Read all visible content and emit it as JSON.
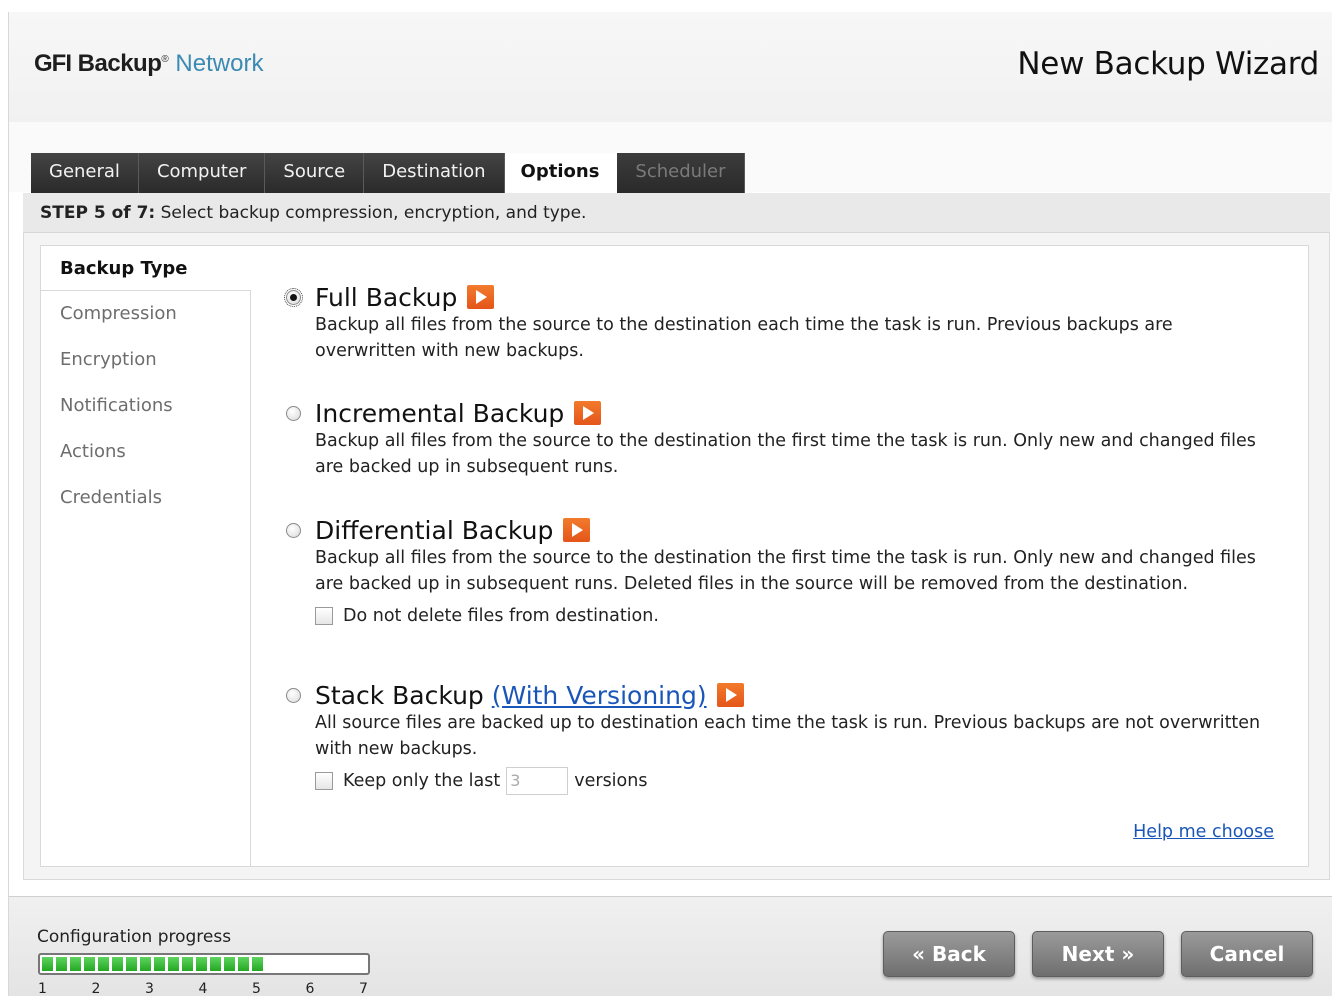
{
  "header": {
    "logo_gfi": "GFI",
    "logo_backup": "Backup",
    "logo_reg": "®",
    "logo_network": "Network",
    "title": "New Backup Wizard"
  },
  "tabs": [
    {
      "label": "General",
      "state": "normal"
    },
    {
      "label": "Computer",
      "state": "normal"
    },
    {
      "label": "Source",
      "state": "normal"
    },
    {
      "label": "Destination",
      "state": "normal"
    },
    {
      "label": "Options",
      "state": "active"
    },
    {
      "label": "Scheduler",
      "state": "disabled"
    }
  ],
  "step": {
    "label": "STEP 5 of 7:",
    "text": " Select backup compression, encryption, and type."
  },
  "side_menu": [
    {
      "label": "Backup Type",
      "active": true
    },
    {
      "label": "Compression",
      "active": false
    },
    {
      "label": "Encryption",
      "active": false
    },
    {
      "label": "Notifications",
      "active": false
    },
    {
      "label": "Actions",
      "active": false
    },
    {
      "label": "Credentials",
      "active": false
    }
  ],
  "options": {
    "full": {
      "title": "Full Backup",
      "selected": true,
      "description": "Backup all files from the source to the destination each time the task is run. Previous backups are overwritten with new backups."
    },
    "incremental": {
      "title": "Incremental Backup",
      "selected": false,
      "description": "Backup all files from the source to the destination the first time the task is run. Only new and changed files are backed up in subsequent runs."
    },
    "differential": {
      "title": "Differential Backup",
      "selected": false,
      "description": "Backup all files from the source to the destination the first time the task is run. Only new and changed files are backed up in subsequent runs. Deleted files in the source will be removed from the destination.",
      "checkbox_label": "Do not delete files from destination.",
      "checkbox_checked": false
    },
    "stack": {
      "title": "Stack Backup",
      "versioning_link": "(With Versioning)",
      "selected": false,
      "description": "All source files are backed up to destination each time the task is run. Previous backups are not overwritten with new backups.",
      "keep_label_before": "Keep only the last",
      "keep_value": "3",
      "keep_label_after": "versions",
      "checkbox_checked": false
    }
  },
  "help_link": "Help me choose",
  "footer": {
    "progress_label": "Configuration progress",
    "progress_fraction": 0.7,
    "progress_steps": [
      "1",
      "2",
      "3",
      "4",
      "5",
      "6",
      "7"
    ],
    "back_label": "« Back",
    "next_label": "Next »",
    "cancel_label": "Cancel"
  },
  "colors": {
    "accent_link": "#1a56b8",
    "play_icon": "#e8601f",
    "progress_green": "#33b833",
    "logo_network": "#3b8ab2"
  }
}
